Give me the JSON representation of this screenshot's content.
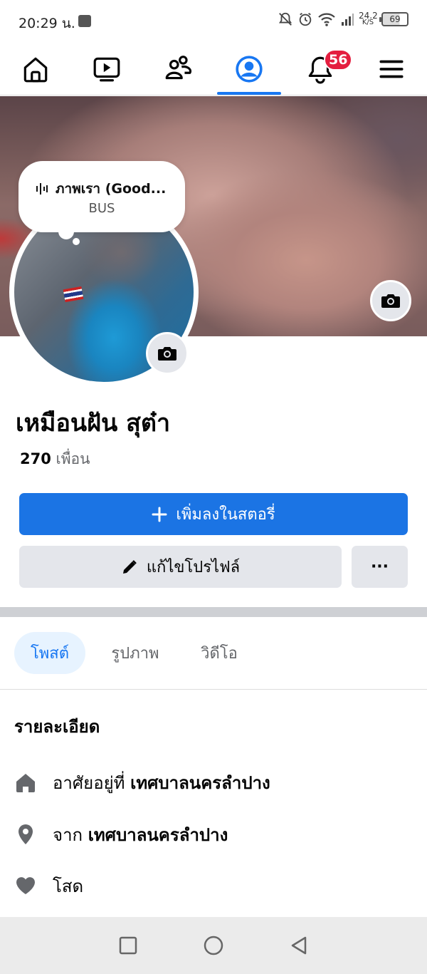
{
  "status_bar": {
    "time": "20:29 น.",
    "net_speed_value": "24.2",
    "net_speed_unit": "K/S",
    "battery": "69",
    "icons": [
      "app-icon",
      "mute-bell-icon",
      "alarm-icon",
      "wifi-icon",
      "signal-icon",
      "battery-icon"
    ]
  },
  "nav": {
    "items": [
      "home-icon",
      "video-icon",
      "friends-icon",
      "profile-icon",
      "notifications-icon",
      "menu-icon"
    ],
    "active": "profile",
    "notification_count": "56"
  },
  "note": {
    "song_title": "ภาพเรา (Good...",
    "artist": "BUS"
  },
  "profile": {
    "name": "เหมือนฝัน สุต๋า",
    "friends_count": "270",
    "friends_label": "เพื่อน"
  },
  "actions": {
    "add_story": "เพิ่มลงในสตอรี่",
    "edit_profile": "แก้ไขโปรไฟล์",
    "more": "···"
  },
  "tabs": [
    {
      "label": "โพสต์",
      "active": true
    },
    {
      "label": "รูปภาพ",
      "active": false
    },
    {
      "label": "วิดีโอ",
      "active": false
    }
  ],
  "details": {
    "title": "รายละเอียด",
    "lives_in_prefix": "อาศัยอยู่ที่",
    "lives_in_place": "เทศบาลนครลำปาง",
    "from_prefix": "จาก",
    "from_place": "เทศบาลนครลำปาง",
    "relationship": "โสด"
  },
  "colors": {
    "brand": "#1877f2",
    "badge": "#e41e3f",
    "secondary_button": "#e4e6eb"
  }
}
